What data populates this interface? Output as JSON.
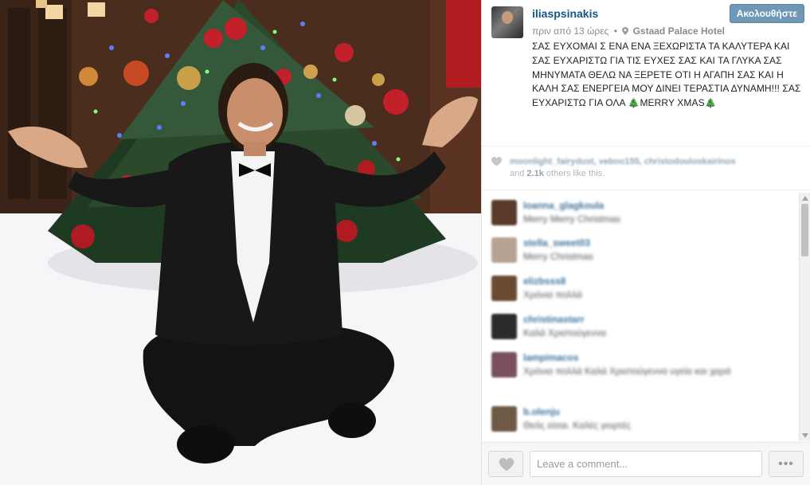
{
  "post": {
    "username": "iliaspsinakis",
    "follow_label": "Ακολουθήστε",
    "time_ago": "πριν από 13 ώρες",
    "location": "Gstaad Palace Hotel",
    "caption": "ΣΑΣ ΕΥΧΟΜΑΙ Σ ΕΝΑ ΕΝΑ ΞΕΧΩΡΙΣΤΑ ΤΑ ΚΑΛΥΤΕΡΑ ΚΑΙ ΣΑΣ ΕΥΧΑΡΙΣΤΩ ΓΙΑ ΤΙΣ ΕΥΧΕΣ ΣΑΣ ΚΑΙ ΤΑ ΓΛΥΚΑ ΣΑΣ ΜΗΝΥΜΑΤΑ ΘΕΛΩ ΝΑ ΞΕΡΕΤΕ ΟΤΙ Η ΑΓΑΠΗ ΣΑΣ ΚΑΙ Η ΚΑΛΗ ΣΑΣ ΕΝΕΡΓΕΙΑ ΜΟΥ ΔΙΝΕΙ ΤΕΡΑΣΤΙΑ ΔΥΝΑΜΗ!!! ΣΑΣ ΕΥΧΑΡΙΣΤΩ ΓΙΑ ΟΛΑ 🎄MERRY XMAS🎄"
  },
  "likes": {
    "names": "moonlight_fairydust, veboo155, christodouloskairinos",
    "and_label": "and",
    "others_count": "2.1k",
    "others_suffix": "others like this."
  },
  "comments": [
    {
      "user": "Ioanna_glagkoula",
      "text": "Merry Merry Christmas",
      "avatar_color": "#5a3a2a"
    },
    {
      "user": "stella_sweet03",
      "text": "Merry Christmas",
      "avatar_color": "#b8a393"
    },
    {
      "user": "elizbsss8",
      "text": "Χρόνια πολλά",
      "avatar_color": "#6b4a32"
    },
    {
      "user": "christinastarr",
      "text": "Καλά Χριστούγεννα",
      "avatar_color": "#2b2b2b"
    },
    {
      "user": "lampimacos",
      "text": "Χρόνια πολλά Καλά Χριστούγεννα υγεία και χαρά",
      "avatar_color": "#7a5060"
    },
    {
      "user": "b.olenju",
      "text": "Θεός είσαι. Καλές γιορτές",
      "avatar_color": "#6e5a44"
    }
  ],
  "footer": {
    "comment_placeholder": "Leave a comment...",
    "more_label": "•••"
  },
  "colors": {
    "username": "#125688",
    "follow_button": "#6f97b6",
    "comment_user": "#3f729b"
  },
  "icons": [
    "pin-icon",
    "heart-icon",
    "scroll-up-icon",
    "scroll-down-icon"
  ]
}
